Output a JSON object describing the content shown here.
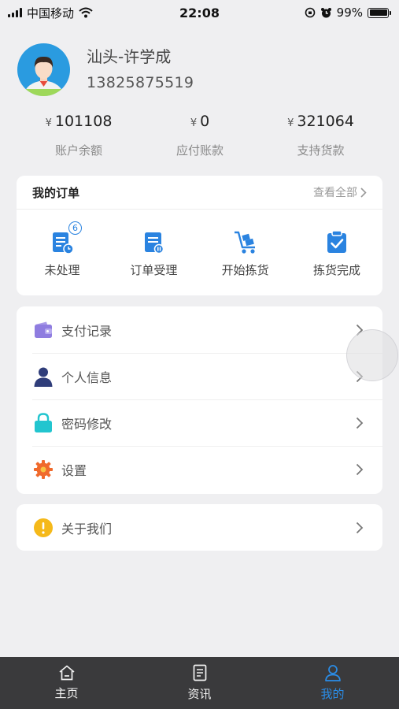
{
  "status_bar": {
    "carrier": "中国移动",
    "time": "22:08",
    "battery": "99%"
  },
  "profile": {
    "name": "汕头-许学成",
    "phone": "13825875519"
  },
  "stats": [
    {
      "currency": "¥",
      "value": "101108",
      "label": "账户余额"
    },
    {
      "currency": "¥",
      "value": "0",
      "label": "应付账款"
    },
    {
      "currency": "¥",
      "value": "321064",
      "label": "支持货款"
    }
  ],
  "orders": {
    "title": "我的订单",
    "view_all": "查看全部",
    "items": [
      {
        "label": "未处理",
        "badge": "6",
        "icon": "pending-order-icon"
      },
      {
        "label": "订单受理",
        "icon": "order-accepted-icon"
      },
      {
        "label": "开始拣货",
        "icon": "picking-cart-icon"
      },
      {
        "label": "拣货完成",
        "icon": "picking-done-icon"
      }
    ]
  },
  "menu": [
    {
      "label": "支付记录",
      "icon": "wallet-icon"
    },
    {
      "label": "个人信息",
      "icon": "person-icon"
    },
    {
      "label": "密码修改",
      "icon": "lock-icon"
    },
    {
      "label": "设置",
      "icon": "gear-icon"
    }
  ],
  "about": {
    "label": "关于我们",
    "icon": "info-icon"
  },
  "tabbar": {
    "items": [
      {
        "label": "主页",
        "icon": "home-icon"
      },
      {
        "label": "资讯",
        "icon": "news-icon"
      },
      {
        "label": "我的",
        "icon": "profile-icon",
        "active": true
      }
    ]
  },
  "colors": {
    "accent": "#2a8de8",
    "tabbar_bg": "#3a3a3c",
    "page_bg": "#efeff1"
  }
}
